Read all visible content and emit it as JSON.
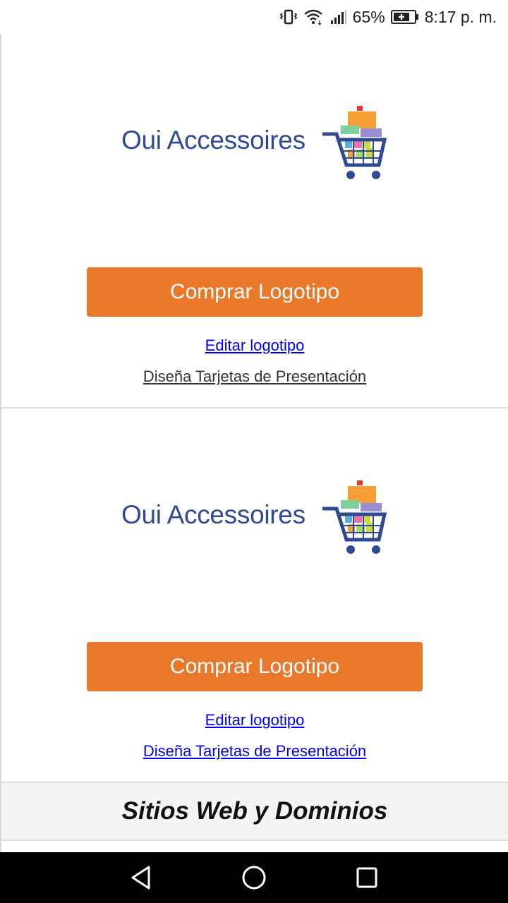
{
  "status_bar": {
    "battery": "65%",
    "time": "8:17 p. m."
  },
  "cards": [
    {
      "logo_text": "Oui Accessoires",
      "buy_label": "Comprar Logotipo",
      "edit_label": "Editar logotipo",
      "business_cards_label": "Diseña Tarjetas de Presentación"
    },
    {
      "logo_text": "Oui Accessoires",
      "buy_label": "Comprar Logotipo",
      "edit_label": "Editar logotipo",
      "business_cards_label": "Diseña Tarjetas de Presentación"
    }
  ],
  "section": {
    "title": "Sitios Web y Dominios"
  },
  "colors": {
    "button": "#ea782b",
    "link": "#0000ee",
    "logo_text": "#2f4a93"
  },
  "icons": {
    "status": [
      "vibrate-icon",
      "wifi-icon",
      "signal-icon",
      "battery-icon"
    ],
    "nav": [
      "back-icon",
      "home-icon",
      "recents-icon"
    ]
  }
}
